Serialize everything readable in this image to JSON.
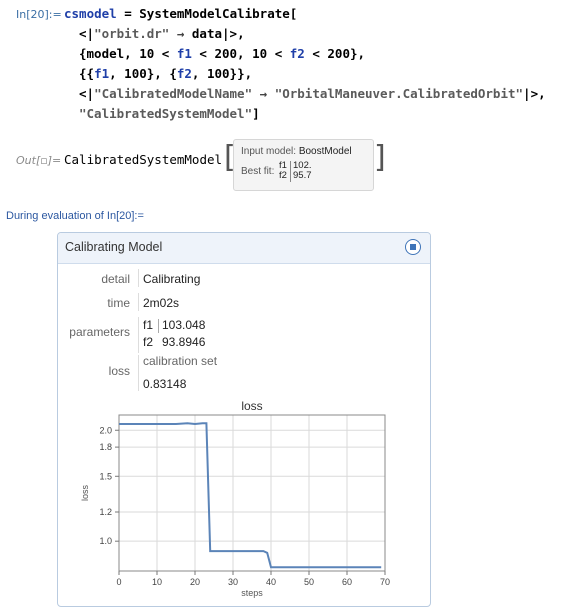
{
  "input": {
    "label": "In[20]:=",
    "line1": {
      "var": "csmodel",
      "eq": " = ",
      "fn": "SystemModelCalibrate",
      "open": "["
    },
    "line2": {
      "open": "<|",
      "key": "\"orbit.dr\"",
      "arrow": " → ",
      "val": "data",
      "close": "|>,"
    },
    "line3": {
      "p1": "{model, 10 < ",
      "f1": "f1",
      "p2": " < 200, 10 < ",
      "f2": "f2",
      "p3": " < 200},"
    },
    "line4": {
      "p1": "{{",
      "f1": "f1",
      "p2": ", 100}, {",
      "f2": "f2",
      "p3": ", 100}},"
    },
    "line5": {
      "open": "<|",
      "key": "\"CalibratedModelName\"",
      "arrow": " → ",
      "val": "\"OrbitalManeuver.CalibratedOrbit\"",
      "close": "|>,"
    },
    "line6": {
      "val": "\"CalibratedSystemModel\"",
      "close": "]"
    }
  },
  "output": {
    "label": "Out[▫]=",
    "head": "CalibratedSystemModel",
    "summary": {
      "input_model_label": "Input model:",
      "input_model_value": "BoostModel",
      "best_fit_label": "Best fit:",
      "params": [
        {
          "name": "f1",
          "value": "102."
        },
        {
          "name": "f2",
          "value": "95.7"
        }
      ]
    }
  },
  "evaluation_message": "During evaluation of In[20]:=",
  "panel": {
    "title": "Calibrating Model",
    "stop_icon": "stop-icon",
    "rows": {
      "detail": {
        "label": "detail",
        "value": "Calibrating"
      },
      "time": {
        "label": "time",
        "value": "2m02s"
      },
      "parameters": {
        "label": "parameters",
        "items": [
          {
            "name": "f1",
            "value": "103.048"
          },
          {
            "name": "f2",
            "value": "93.8946"
          }
        ]
      },
      "loss": {
        "label": "loss",
        "sublabel": "calibration set",
        "value": "0.83148"
      }
    }
  },
  "chart_data": {
    "type": "line",
    "title": "loss",
    "xlabel": "steps",
    "ylabel": "loss",
    "log_y": true,
    "xlim": [
      0,
      70
    ],
    "ylim": [
      0.83,
      2.2
    ],
    "xticks": [
      0,
      10,
      20,
      30,
      40,
      50,
      60,
      70
    ],
    "yticks": [
      1.0,
      1.2,
      1.5,
      1.8,
      2.0
    ],
    "ytick_labels": [
      "1.0",
      "1.2",
      "1.5",
      "1.8",
      "2.0"
    ],
    "grid": true,
    "line_color": "#5b84b8",
    "x": [
      0,
      10,
      15,
      18,
      20,
      22,
      23,
      24,
      30,
      35,
      38,
      39,
      40,
      50,
      60,
      69
    ],
    "y": [
      2.08,
      2.08,
      2.08,
      2.09,
      2.08,
      2.09,
      2.09,
      0.94,
      0.94,
      0.94,
      0.94,
      0.93,
      0.85,
      0.85,
      0.85,
      0.85
    ]
  }
}
